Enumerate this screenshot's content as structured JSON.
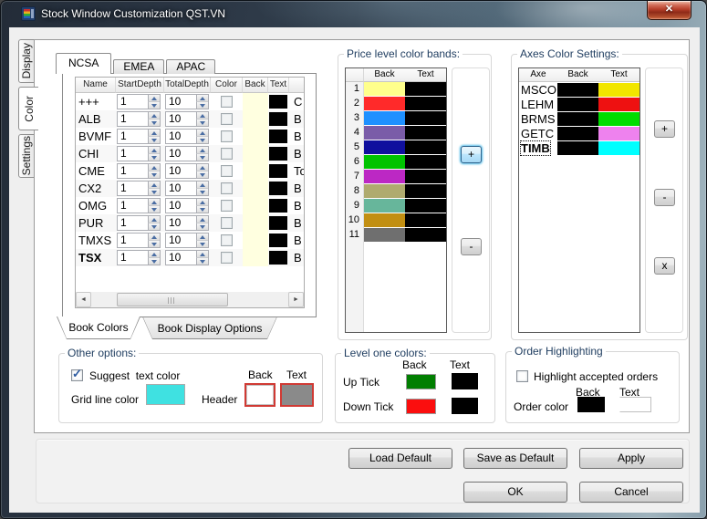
{
  "window": {
    "title": "Stock Window Customization QST.VN"
  },
  "icons": {
    "close": "✕",
    "check": "✓",
    "scroll_left": "◄",
    "scroll_right": "►"
  },
  "side_tabs": [
    {
      "label": "Display",
      "active": false
    },
    {
      "label": "Color",
      "active": true
    },
    {
      "label": "Settings",
      "active": false
    }
  ],
  "book_tabs": [
    {
      "label": "NCSA",
      "active": true
    },
    {
      "label": "EMEA",
      "active": false
    },
    {
      "label": "APAC",
      "active": false
    }
  ],
  "book_table": {
    "columns": [
      "Name",
      "StartDepth",
      "TotalDepth",
      "Color",
      "Back",
      "Text",
      ""
    ],
    "back_column_color": "#FFFFE0",
    "text_column_color": "#000000",
    "rows": [
      {
        "name": "+++",
        "start_depth": "1",
        "total_depth": "10",
        "clipped": "C",
        "bold": false
      },
      {
        "name": "ALB",
        "start_depth": "1",
        "total_depth": "10",
        "clipped": "B",
        "bold": false
      },
      {
        "name": "BVMF",
        "start_depth": "1",
        "total_depth": "10",
        "clipped": "B",
        "bold": false
      },
      {
        "name": "CHI",
        "start_depth": "1",
        "total_depth": "10",
        "clipped": "B",
        "bold": false
      },
      {
        "name": "CME",
        "start_depth": "1",
        "total_depth": "10",
        "clipped": "To",
        "bold": false
      },
      {
        "name": "CX2",
        "start_depth": "1",
        "total_depth": "10",
        "clipped": "B",
        "bold": false
      },
      {
        "name": "OMG",
        "start_depth": "1",
        "total_depth": "10",
        "clipped": "B",
        "bold": false
      },
      {
        "name": "PUR",
        "start_depth": "1",
        "total_depth": "10",
        "clipped": "B",
        "bold": false
      },
      {
        "name": "TMXS",
        "start_depth": "1",
        "total_depth": "10",
        "clipped": "B",
        "bold": false
      },
      {
        "name": "TSX",
        "start_depth": "1",
        "total_depth": "10",
        "clipped": "B",
        "bold": true
      }
    ]
  },
  "bottom_tabs": [
    {
      "label": "Book Colors",
      "active": true
    },
    {
      "label": "Book Display Options",
      "active": false
    }
  ],
  "price_bands": {
    "title": "Price level color bands:",
    "columns": [
      "Back",
      "Text"
    ],
    "add_label": "+",
    "remove_label": "-",
    "rows": [
      {
        "n": "1",
        "back": "#FFFF8C",
        "text": "#000000"
      },
      {
        "n": "2",
        "back": "#FF2A2A",
        "text": "#000000"
      },
      {
        "n": "3",
        "back": "#1E90FF",
        "text": "#000000"
      },
      {
        "n": "4",
        "back": "#7A5CA8",
        "text": "#000000"
      },
      {
        "n": "5",
        "back": "#10109E",
        "text": "#000000"
      },
      {
        "n": "6",
        "back": "#00C300",
        "text": "#000000"
      },
      {
        "n": "7",
        "back": "#BC28C4",
        "text": "#000000"
      },
      {
        "n": "8",
        "back": "#AFAB6F",
        "text": "#000000"
      },
      {
        "n": "9",
        "back": "#67B69B",
        "text": "#000000"
      },
      {
        "n": "10",
        "back": "#C28F12",
        "text": "#000000"
      },
      {
        "n": "11",
        "back": "#6F6F6F",
        "text": "#000000"
      }
    ]
  },
  "axes_colors": {
    "title": "Axes Color Settings:",
    "columns": [
      "Axe",
      "Back",
      "Text"
    ],
    "add_label": "+",
    "remove_label": "-",
    "delete_label": "x",
    "rows": [
      {
        "axe": "MSCO",
        "back": "#000000",
        "text": "#F2E600",
        "bold": false
      },
      {
        "axe": "LEHM",
        "back": "#000000",
        "text": "#EE1111",
        "bold": false
      },
      {
        "axe": "BRMS",
        "back": "#000000",
        "text": "#00DD00",
        "bold": false
      },
      {
        "axe": "GETC",
        "back": "#000000",
        "text": "#EE82EE",
        "bold": false
      },
      {
        "axe": "TIMB",
        "back": "#000000",
        "text": "#00FFFF",
        "bold": true
      }
    ]
  },
  "other_options": {
    "title": "Other options:",
    "suggest_label": "Suggest  text color",
    "suggest_checked": true,
    "grid_line_label": "Grid line color",
    "grid_line_color": "#3FE1E1",
    "header_label": "Header",
    "back_heading": "Back",
    "text_heading": "Text",
    "header_back_color": "#FFFFFF",
    "header_text_color": "#8A8A8A",
    "selected_swatch_border": "#D03A34"
  },
  "level_one": {
    "title": "Level one colors:",
    "back_heading": "Back",
    "text_heading": "Text",
    "rows": [
      {
        "label": "Up Tick",
        "back": "#017F01",
        "text": "#000000"
      },
      {
        "label": "Down Tick",
        "back": "#FB0E0E",
        "text": "#000000"
      }
    ]
  },
  "order_highlighting": {
    "title": "Order Highlighting",
    "checkbox_label": "Highlight accepted orders",
    "checked": false,
    "order_color_label": "Order color",
    "back_heading": "Back",
    "text_heading": "Text",
    "back": "#000000",
    "text": "#FFFFFF"
  },
  "action_buttons": {
    "load_default": "Load Default",
    "save_as_default": "Save as Default",
    "apply": "Apply",
    "ok": "OK",
    "cancel": "Cancel"
  }
}
